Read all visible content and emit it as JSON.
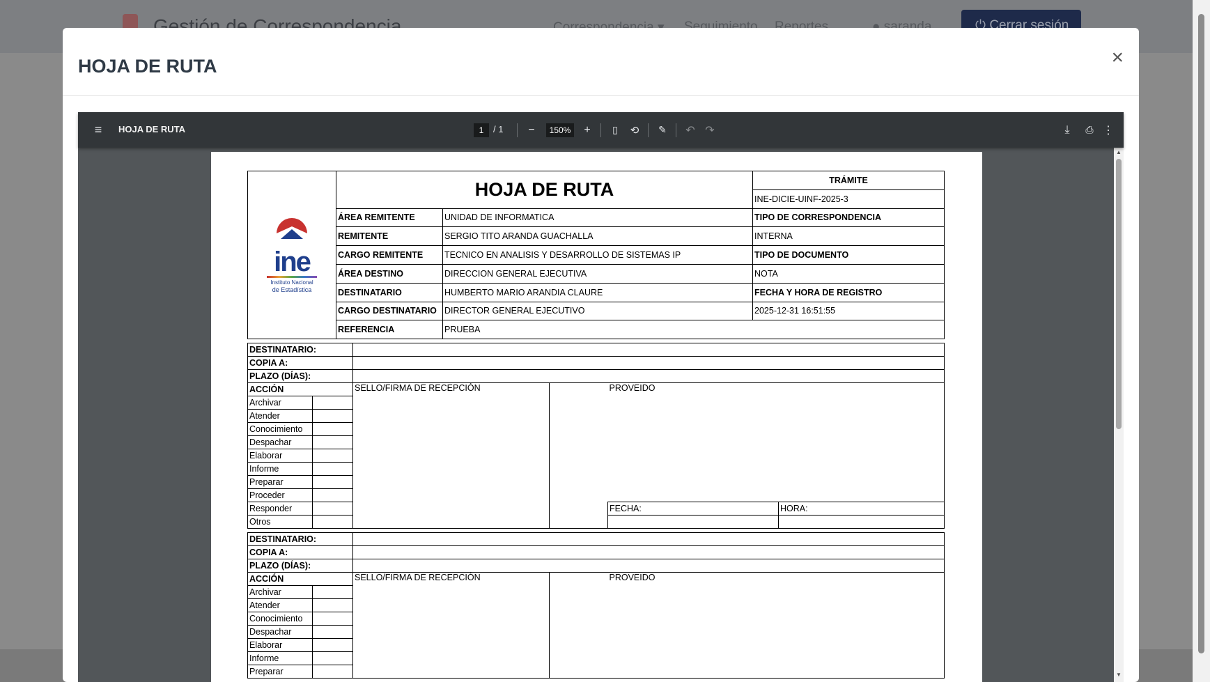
{
  "app": {
    "title": "Gestión de Correspondencia",
    "nav": [
      "Correspondencia ▾",
      "Seguimiento",
      "Reportes"
    ],
    "user": "saranda",
    "logout_label": "Cerrar sesión"
  },
  "modal": {
    "title": "HOJA DE RUTA",
    "close_label": "×"
  },
  "viewer": {
    "doc_title": "HOJA DE RUTA",
    "page_current": "1",
    "page_total": "/ 1",
    "zoom": "150%"
  },
  "document": {
    "heading": "HOJA DE RUTA",
    "logo_text": "ine",
    "logo_sub1": "Instituto Nacional",
    "logo_sub2": "de Estadística",
    "tramite_label": "TRÁMITE",
    "tramite_value": "INE-DICIE-UINF-2025-3",
    "rows": [
      {
        "label": "ÁREA REMITENTE",
        "value": "UNIDAD DE INFORMATICA",
        "side": "TIPO DE CORRESPONDENCIA",
        "side_bold": true
      },
      {
        "label": "REMITENTE",
        "value": "SERGIO TITO ARANDA GUACHALLA",
        "side": "INTERNA",
        "side_bold": false
      },
      {
        "label": "CARGO REMITENTE",
        "value": "TECNICO EN ANALISIS Y DESARROLLO DE SISTEMAS IP",
        "side": "TIPO DE DOCUMENTO",
        "side_bold": true
      },
      {
        "label": "ÁREA DESTINO",
        "value": "DIRECCION GENERAL EJECUTIVA",
        "side": "NOTA",
        "side_bold": false
      },
      {
        "label": "DESTINATARIO",
        "value": "HUMBERTO MARIO ARANDIA CLAURE",
        "side": "FECHA Y HORA DE REGISTRO",
        "side_bold": true
      },
      {
        "label": "CARGO DESTINATARIO",
        "value": "DIRECTOR GENERAL EJECUTIVO",
        "side": "2025-12-31 16:51:55",
        "side_bold": false
      }
    ],
    "referencia_label": "REFERENCIA",
    "referencia_value": "PRUEBA",
    "route": {
      "destinatario": "DESTINATARIO:",
      "copia": "COPIA A:",
      "plazo": "PLAZO (DÍAS):",
      "accion": "ACCIÓN",
      "sello": "SELLO/FIRMA DE RECEPCIÓN",
      "proveido": "PROVEIDO",
      "fecha": "FECHA:",
      "hora": "HORA:",
      "acciones": [
        "Archivar",
        "Atender",
        "Conocimiento",
        "Despachar",
        "Elaborar",
        "Informe",
        "Preparar",
        "Proceder",
        "Responder",
        "Otros"
      ]
    }
  }
}
